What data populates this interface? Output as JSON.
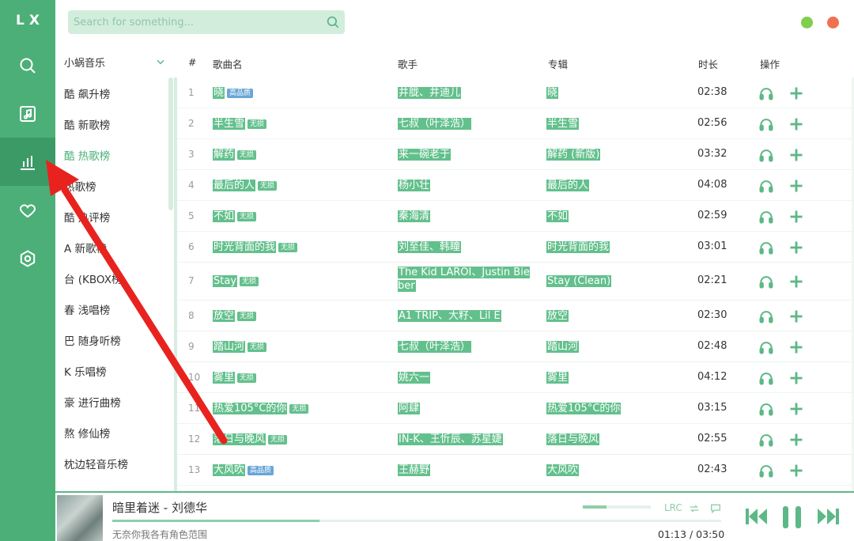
{
  "app": {
    "logo": "LX"
  },
  "colors": {
    "accent": "#4caf78",
    "accent_dark": "#3c9a66",
    "highlight": "#63c08c",
    "min_dot": "#7fcf4d",
    "close_dot": "#f0714f",
    "annotation_arrow": "#e8231f"
  },
  "rail": {
    "items": [
      {
        "icon": "search-icon"
      },
      {
        "icon": "music-list-icon"
      },
      {
        "icon": "leaderboard-icon",
        "active": true
      },
      {
        "icon": "heart-icon"
      },
      {
        "icon": "settings-icon"
      }
    ]
  },
  "search": {
    "placeholder": "Search for something...",
    "icon": "search-icon"
  },
  "source": {
    "selected": "小蜗音乐",
    "items": [
      "酷 飙升榜",
      "酷 新歌榜",
      "酷 热歌榜",
      "热歌榜",
      "酷 热评榜",
      "A 新歌榜",
      "台 (KBOX榜",
      "春 浅唱榜",
      "巴 随身听榜",
      "K 乐唱榜",
      "豪 进行曲榜",
      "熬 修仙榜",
      "枕边轻音乐榜"
    ],
    "active_index": 2
  },
  "table": {
    "headers": {
      "num": "#",
      "name": "歌曲名",
      "singer": "歌手",
      "album": "专辑",
      "duration": "时长",
      "ops": "操作"
    },
    "rows": [
      {
        "num": "1",
        "name": "晓",
        "tag": "高品质",
        "tag_type": "hq",
        "singer": "井胧、井迪儿",
        "album": "晓",
        "duration": "02:38"
      },
      {
        "num": "2",
        "name": "半生雪",
        "tag": "无损",
        "tag_type": "ls",
        "singer": "七叔（叶泽浩）",
        "album": "半生雪",
        "duration": "02:56"
      },
      {
        "num": "3",
        "name": "解药",
        "tag": "无损",
        "tag_type": "ls",
        "singer": "来一碗老于",
        "album": "解药 (新版)",
        "duration": "03:32"
      },
      {
        "num": "4",
        "name": "最后的人",
        "tag": "无损",
        "tag_type": "ls",
        "singer": "杨小壮",
        "album": "最后的人",
        "duration": "04:08"
      },
      {
        "num": "5",
        "name": "不如",
        "tag": "无损",
        "tag_type": "ls",
        "singer": "秦海清",
        "album": "不如",
        "duration": "02:59"
      },
      {
        "num": "6",
        "name": "时光背面的我",
        "tag": "无损",
        "tag_type": "ls",
        "singer": "刘至佳、韩瞳",
        "album": "时光背面的我",
        "duration": "03:01"
      },
      {
        "num": "7",
        "name": "Stay",
        "tag": "无损",
        "tag_type": "ls",
        "singer": "The Kid LAROI、Justin Bieber",
        "album": "Stay (Clean)",
        "duration": "02:21",
        "tall": true
      },
      {
        "num": "8",
        "name": "放空",
        "tag": "无损",
        "tag_type": "ls",
        "singer": "A1 TRIP、大籽、Lil E",
        "album": "放空",
        "duration": "02:30"
      },
      {
        "num": "9",
        "name": "踏山河",
        "tag": "无损",
        "tag_type": "ls",
        "singer": "七叔（叶泽浩）",
        "album": "踏山河",
        "duration": "02:48"
      },
      {
        "num": "10",
        "name": "雾里",
        "tag": "无损",
        "tag_type": "ls",
        "singer": "姚六一",
        "album": "雾里",
        "duration": "04:12"
      },
      {
        "num": "11",
        "name": "热爱105°C的你",
        "tag": "无损",
        "tag_type": "ls",
        "singer": "阿肆",
        "album": "热爱105°C的你",
        "duration": "03:15"
      },
      {
        "num": "12",
        "name": "落日与晚风",
        "tag": "无损",
        "tag_type": "ls",
        "singer": "IN-K、王忻辰、苏星婕",
        "album": "落日与晚风",
        "duration": "02:55"
      },
      {
        "num": "13",
        "name": "大风吹",
        "tag": "高品质",
        "tag_type": "hq",
        "singer": "王赫野",
        "album": "大风吹",
        "duration": "02:43"
      }
    ]
  },
  "player": {
    "title": "暗里着迷 - 刘德华",
    "lyric": "无奈你我各有角色范围",
    "time": "01:13 / 03:50",
    "progress": 0.34,
    "volume": 0.35,
    "lrc_label": "LRC"
  }
}
